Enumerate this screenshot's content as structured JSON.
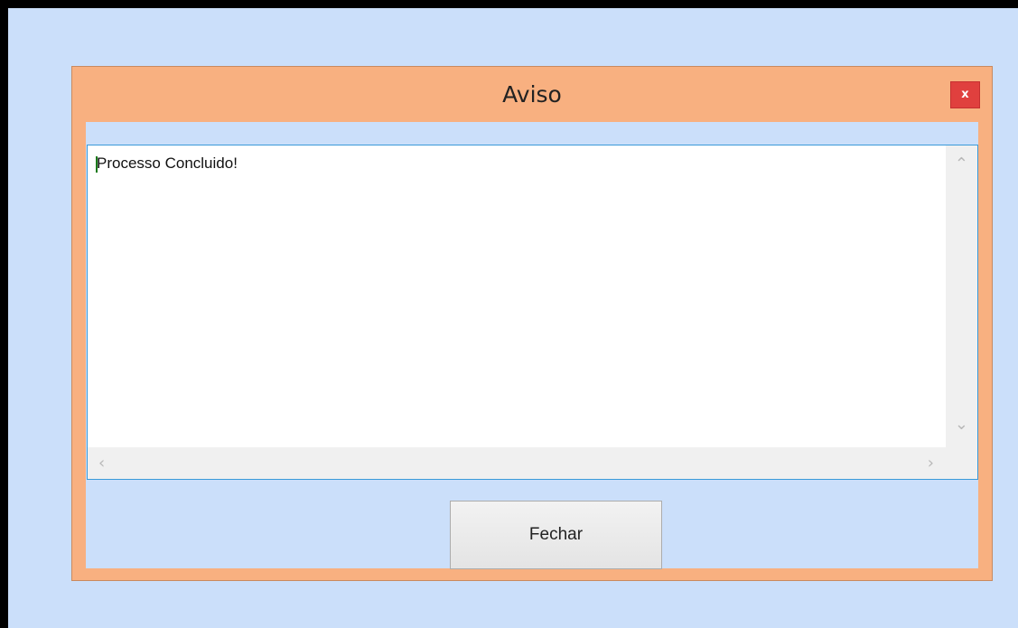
{
  "dialog": {
    "title": "Aviso",
    "close_label": "x",
    "message": "Processo Concluido!",
    "button_label": "Fechar"
  },
  "scrollbar": {
    "up_icon": "chevron-up-icon",
    "down_icon": "chevron-down-icon",
    "left_icon": "chevron-left-icon",
    "right_icon": "chevron-right-icon"
  },
  "colors": {
    "background": "#cbdffa",
    "dialog_frame": "#f8b080",
    "close_button": "#e0403e",
    "textarea_border": "#3a9ad9"
  }
}
